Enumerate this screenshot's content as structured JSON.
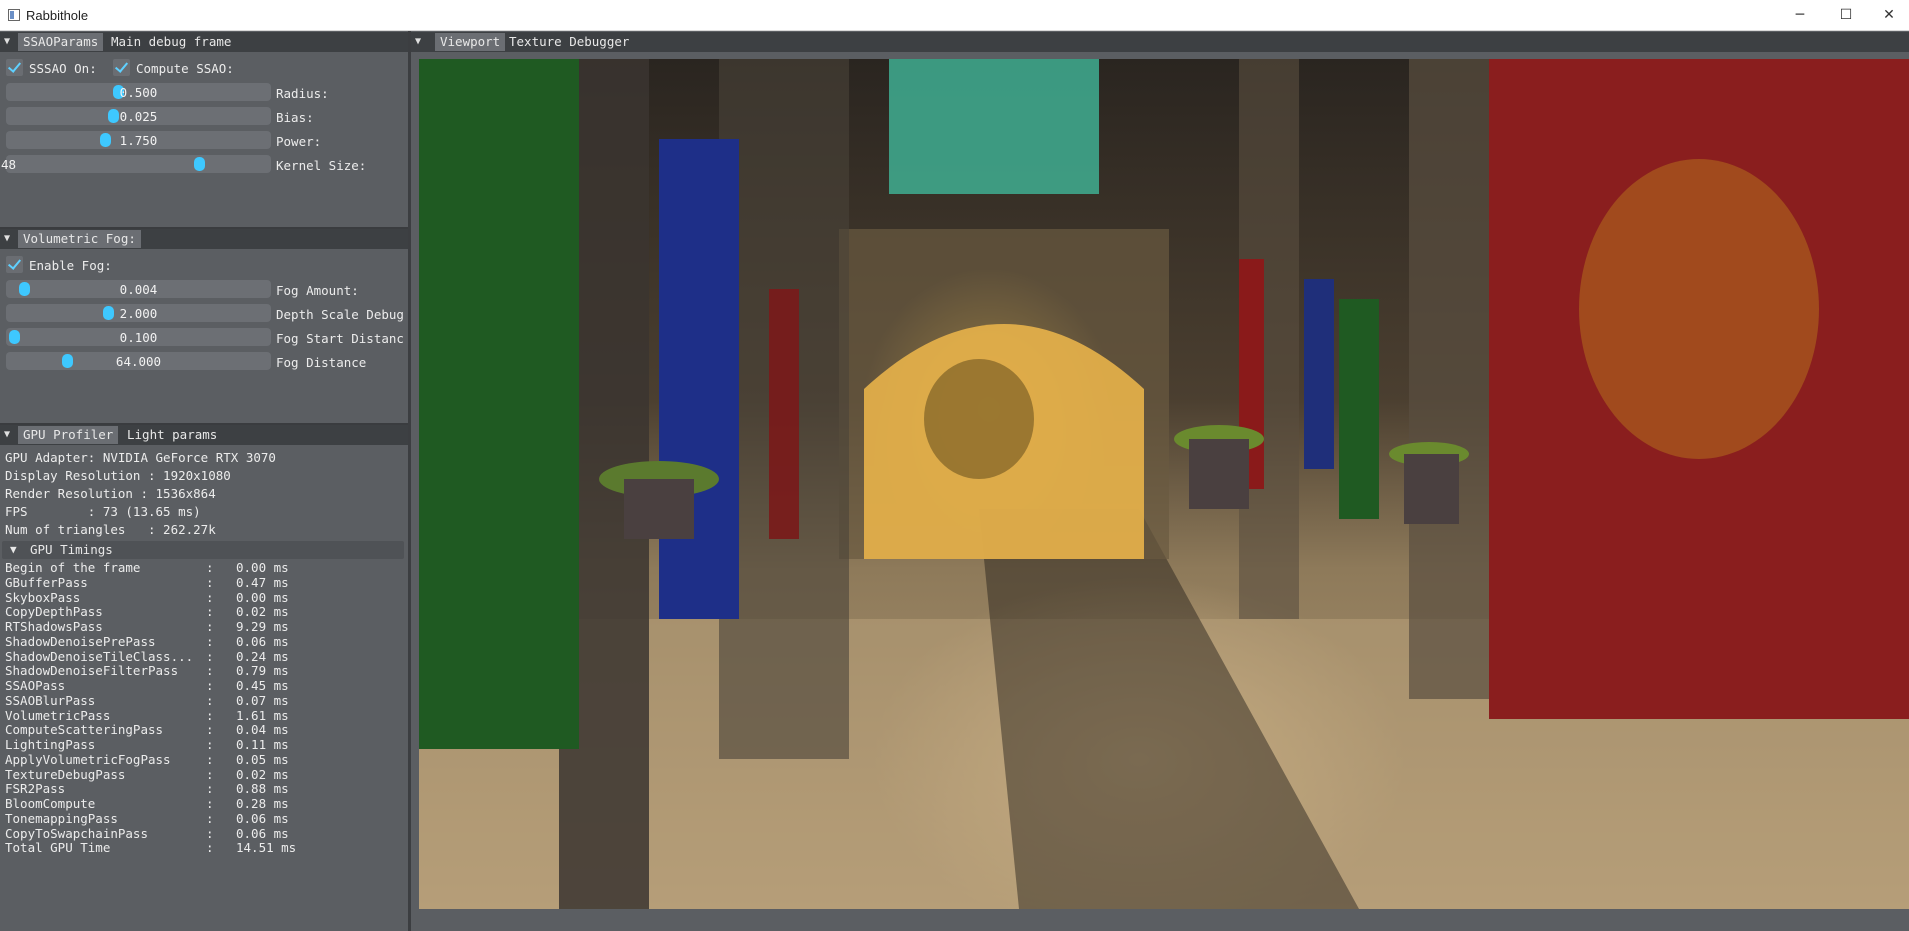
{
  "window": {
    "title": "Rabbithole",
    "minimize_glyph": "─",
    "maximize_glyph": "☐",
    "close_glyph": "✕"
  },
  "ssao": {
    "tabs": [
      "SSAOParams",
      "Main debug frame"
    ],
    "sssao_on_label": "SSSAO On:",
    "compute_ssao_label": "Compute SSAO:",
    "sliders": [
      {
        "value": "0.500",
        "label": "Radius:",
        "level": 0.42
      },
      {
        "value": "0.025",
        "label": "Bias:",
        "level": 0.4
      },
      {
        "value": "1.750",
        "label": "Power:",
        "level": 0.37
      },
      {
        "value": "48",
        "label": "Kernel Size:",
        "level": 0.74
      }
    ]
  },
  "fog": {
    "tab": "Volumetric Fog:",
    "enable_label": "Enable Fog:",
    "sliders": [
      {
        "value": "0.004",
        "label": "Fog Amount:",
        "level": 0.05
      },
      {
        "value": "2.000",
        "label": "Depth Scale Debug",
        "level": 0.38
      },
      {
        "value": "0.100",
        "label": "Fog Start Distanc",
        "level": 0.01
      },
      {
        "value": "64.000",
        "label": "Fog Distance",
        "level": 0.22
      }
    ]
  },
  "profiler": {
    "tabs": [
      "GPU Profiler",
      "Light params"
    ],
    "info": [
      "GPU Adapter: NVIDIA GeForce RTX 3070",
      "Display Resolution : 1920x1080",
      "Render Resolution : 1536x864",
      "FPS        : 73 (13.65 ms)",
      "Num of triangles   : 262.27k"
    ],
    "timings_header": "GPU Timings",
    "timings": [
      {
        "name": "Begin of the frame",
        "value": "0.00 ms"
      },
      {
        "name": "GBufferPass",
        "value": "0.47 ms"
      },
      {
        "name": "SkyboxPass",
        "value": "0.00 ms"
      },
      {
        "name": "CopyDepthPass",
        "value": "0.02 ms"
      },
      {
        "name": "RTShadowsPass",
        "value": "9.29 ms"
      },
      {
        "name": "ShadowDenoisePrePass",
        "value": "0.06 ms"
      },
      {
        "name": "ShadowDenoiseTileClass...",
        "value": "0.24 ms"
      },
      {
        "name": "ShadowDenoiseFilterPass",
        "value": "0.79 ms"
      },
      {
        "name": "SSAOPass",
        "value": "0.45 ms"
      },
      {
        "name": "SSAOBlurPass",
        "value": "0.07 ms"
      },
      {
        "name": "VolumetricPass",
        "value": "1.61 ms"
      },
      {
        "name": "ComputeScatteringPass",
        "value": "0.04 ms"
      },
      {
        "name": "LightingPass",
        "value": "0.11 ms"
      },
      {
        "name": "ApplyVolumetricFogPass",
        "value": "0.05 ms"
      },
      {
        "name": "TextureDebugPass",
        "value": "0.02 ms"
      },
      {
        "name": "FSR2Pass",
        "value": "0.88 ms"
      },
      {
        "name": "BloomCompute",
        "value": "0.28 ms"
      },
      {
        "name": "TonemappingPass",
        "value": "0.06 ms"
      },
      {
        "name": "CopyToSwapchainPass",
        "value": "0.06 ms"
      },
      {
        "name": "Total GPU Time",
        "value": "14.51 ms"
      }
    ]
  },
  "viewport": {
    "tabs": [
      "Viewport",
      "Texture Debugger"
    ]
  }
}
